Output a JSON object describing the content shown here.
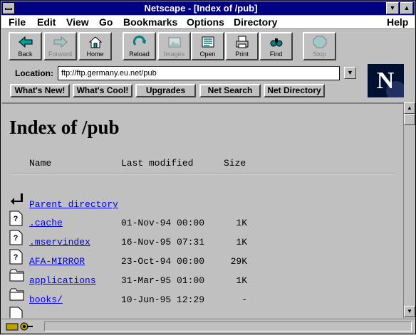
{
  "window": {
    "title": "Netscape - [Index of /pub]"
  },
  "menubar": {
    "items": [
      {
        "label": "File"
      },
      {
        "label": "Edit"
      },
      {
        "label": "View"
      },
      {
        "label": "Go"
      },
      {
        "label": "Bookmarks"
      },
      {
        "label": "Options"
      },
      {
        "label": "Directory"
      },
      {
        "label": "Help"
      }
    ]
  },
  "toolbar": {
    "buttons": [
      {
        "label": "Back",
        "icon": "back-arrow-icon",
        "enabled": true
      },
      {
        "label": "Forward",
        "icon": "forward-arrow-icon",
        "enabled": false
      },
      {
        "label": "Home",
        "icon": "home-icon",
        "enabled": true
      },
      {
        "label": "Reload",
        "icon": "reload-icon",
        "enabled": true
      },
      {
        "label": "Images",
        "icon": "images-icon",
        "enabled": false
      },
      {
        "label": "Open",
        "icon": "open-icon",
        "enabled": true
      },
      {
        "label": "Print",
        "icon": "print-icon",
        "enabled": true
      },
      {
        "label": "Find",
        "icon": "find-icon",
        "enabled": true
      },
      {
        "label": "Stop",
        "icon": "stop-icon",
        "enabled": false
      }
    ]
  },
  "location": {
    "label": "Location:",
    "value": "ftp://ftp.germany.eu.net/pub"
  },
  "directory_buttons": [
    {
      "label": "What's New!"
    },
    {
      "label": "What's Cool!"
    },
    {
      "label": "Upgrades"
    },
    {
      "label": "Net Search"
    },
    {
      "label": "Net Directory"
    }
  ],
  "logo": {
    "letter": "N"
  },
  "content": {
    "title": "Index of /pub",
    "columns": {
      "name": "Name",
      "modified": "Last modified",
      "size": "Size"
    },
    "parent": {
      "label": "Parent directory"
    },
    "files": [
      {
        "name": ".cache",
        "modified": "01-Nov-94 00:00",
        "size": "1K",
        "icon": "unknown-file-icon"
      },
      {
        "name": ".mservindex",
        "modified": "16-Nov-95 07:31",
        "size": "1K",
        "icon": "unknown-file-icon"
      },
      {
        "name": "AFA-MIRROR",
        "modified": "23-Oct-94 00:00",
        "size": "29K",
        "icon": "unknown-file-icon"
      },
      {
        "name": "applications",
        "modified": "31-Mar-95 01:00",
        "size": "1K",
        "icon": "folder-icon"
      },
      {
        "name": "books/",
        "modified": "10-Jun-95 12:29",
        "size": "-",
        "icon": "folder-icon"
      }
    ]
  },
  "status": {
    "text": ""
  },
  "colors": {
    "titlebar": "#000080",
    "link": "#0000ee",
    "chrome": "#c0c0c0"
  }
}
